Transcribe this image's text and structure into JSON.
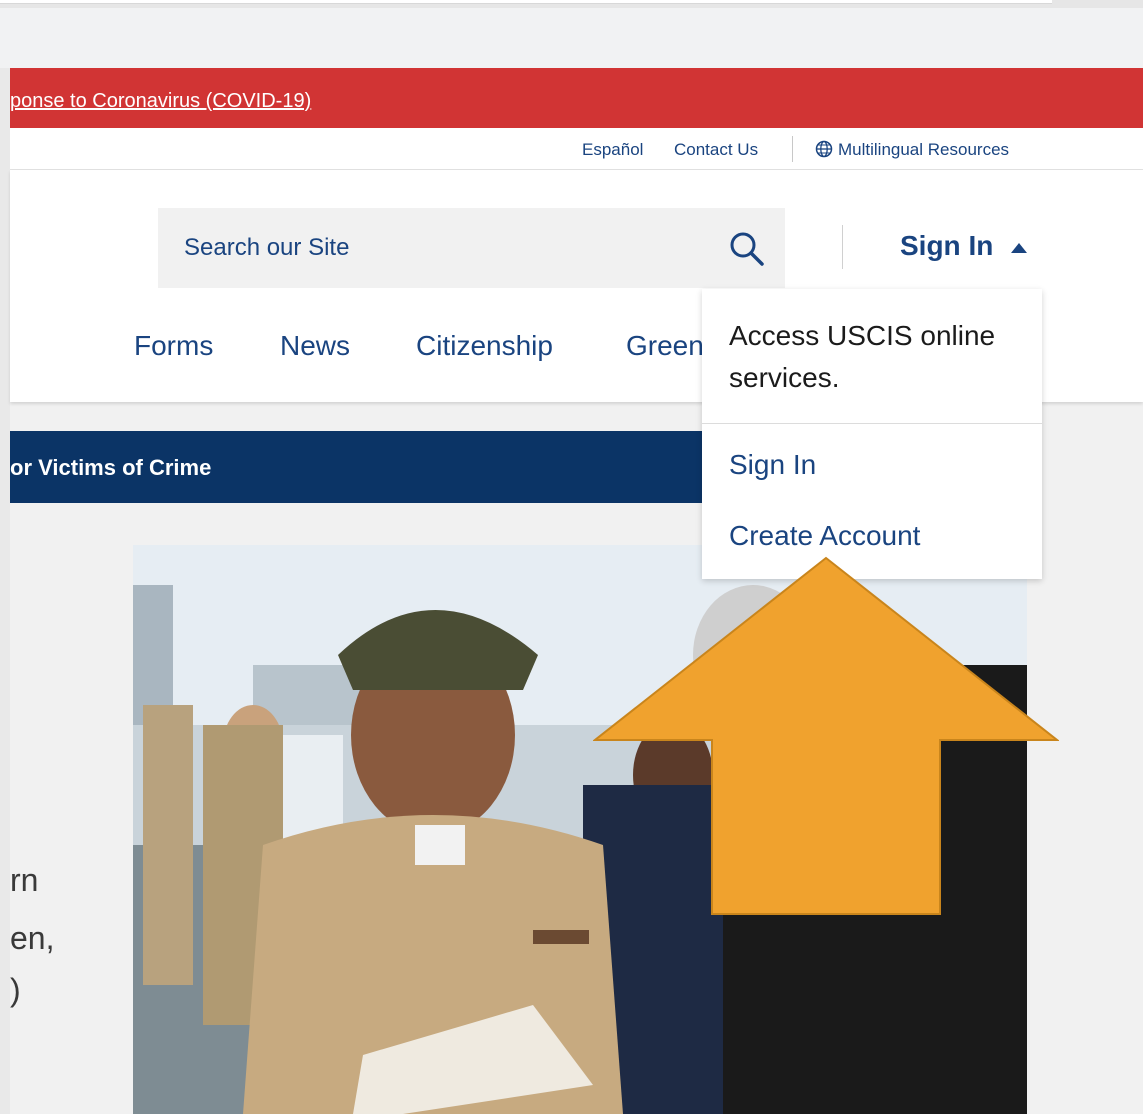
{
  "alert": {
    "text": "ponse to Coronavirus (COVID-19)",
    "bg_color": "#d13434"
  },
  "utility_nav": {
    "espanol": "Español",
    "contact": "Contact Us",
    "multilingual": "Multilingual Resources",
    "globe_icon": "globe-icon"
  },
  "search": {
    "placeholder": "Search our Site",
    "icon": "search-icon"
  },
  "signin": {
    "label": "Sign In",
    "icon": "caret-up-icon"
  },
  "main_nav": {
    "items": [
      "Forms",
      "News",
      "Citizenship",
      "Green"
    ]
  },
  "banner": {
    "text": "or Victims of Crime",
    "bg_color": "#0b3466"
  },
  "dropdown": {
    "description": "Access USCIS online services.",
    "signin_link": "Sign In",
    "create_account_link": "Create Account"
  },
  "partial_body_text": [
    "rn",
    "en,",
    ")"
  ],
  "accent_color": "#1a4480",
  "arrow_color": "#f0a22e"
}
